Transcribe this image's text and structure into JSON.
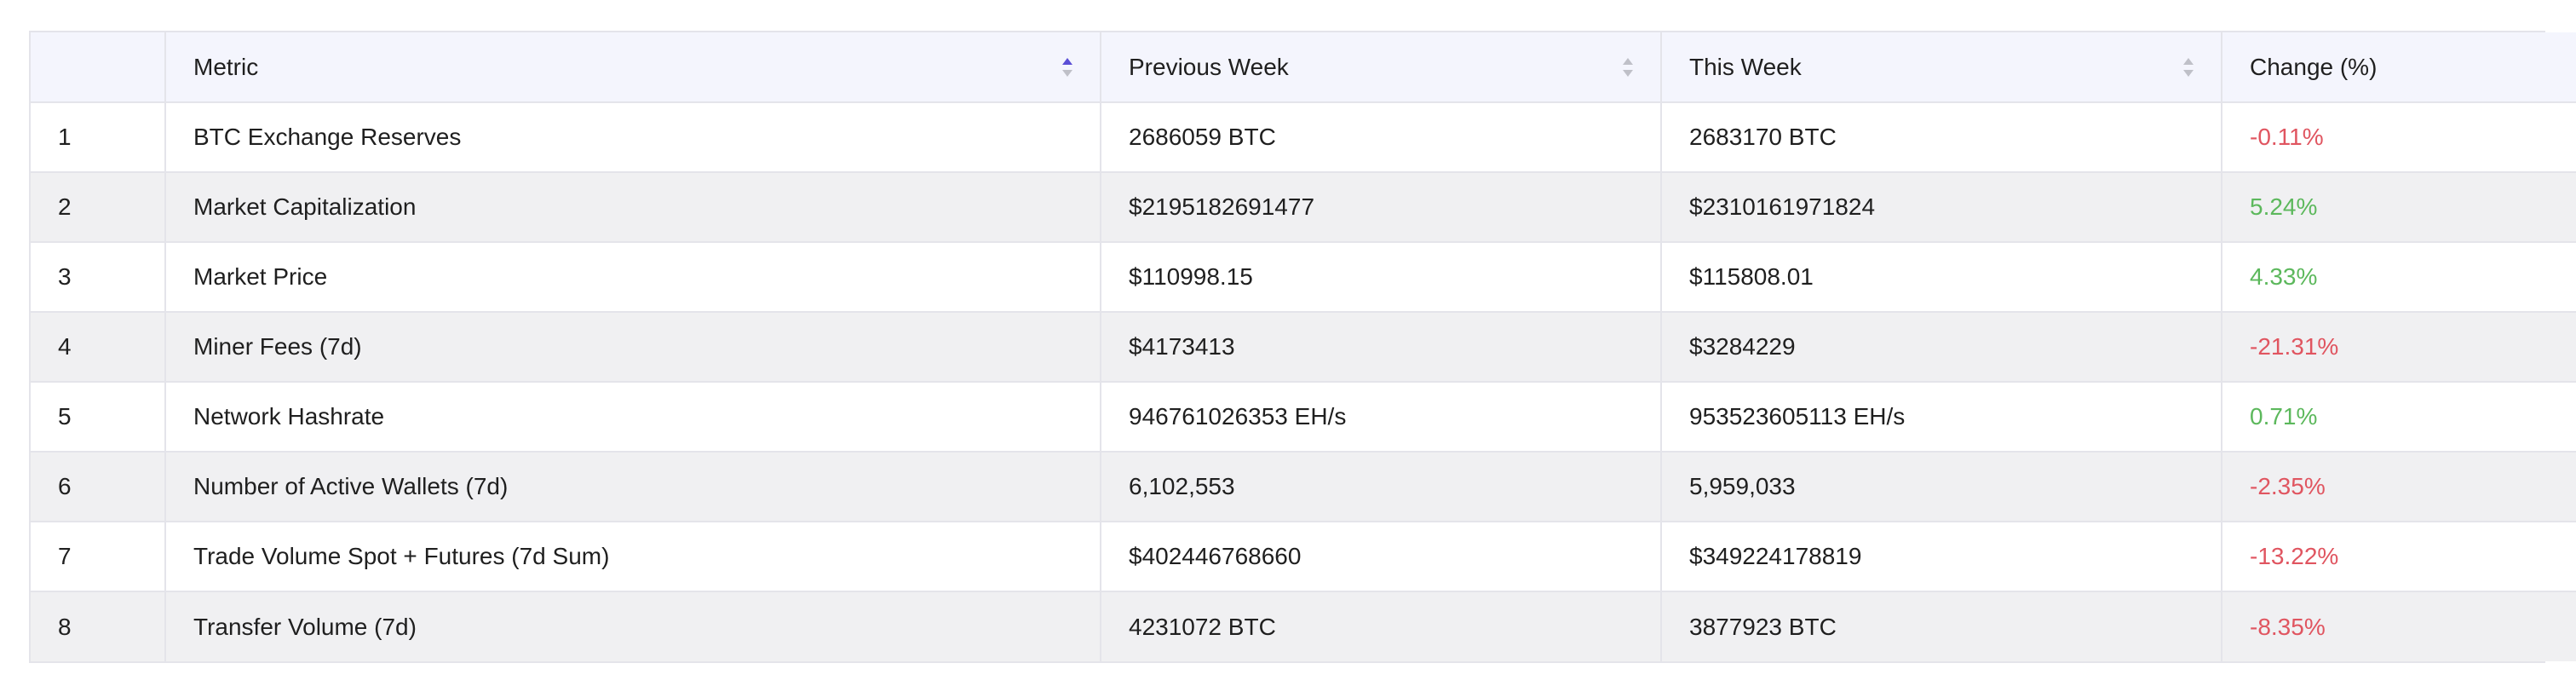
{
  "table": {
    "columns": [
      {
        "label": "",
        "sort": "none"
      },
      {
        "label": "Metric",
        "sort": "asc"
      },
      {
        "label": "Previous Week",
        "sort": "none"
      },
      {
        "label": "This Week",
        "sort": "none"
      },
      {
        "label": "Change (%)",
        "sort": "none"
      }
    ],
    "rows": [
      {
        "index": "1",
        "metric": "BTC Exchange Reserves",
        "previous": "2686059 BTC",
        "current": "2683170 BTC",
        "change": "-0.11%",
        "trend": "negative"
      },
      {
        "index": "2",
        "metric": "Market Capitalization",
        "previous": "$2195182691477",
        "current": "$2310161971824",
        "change": "5.24%",
        "trend": "positive"
      },
      {
        "index": "3",
        "metric": "Market Price",
        "previous": "$110998.15",
        "current": "$115808.01",
        "change": "4.33%",
        "trend": "positive"
      },
      {
        "index": "4",
        "metric": "Miner Fees (7d)",
        "previous": "$4173413",
        "current": "$3284229",
        "change": "-21.31%",
        "trend": "negative"
      },
      {
        "index": "5",
        "metric": "Network Hashrate",
        "previous": "946761026353 EH/s",
        "current": "953523605113 EH/s",
        "change": "0.71%",
        "trend": "positive"
      },
      {
        "index": "6",
        "metric": "Number of Active Wallets (7d)",
        "previous": "6,102,553",
        "current": "5,959,033",
        "change": "-2.35%",
        "trend": "negative"
      },
      {
        "index": "7",
        "metric": "Trade Volume Spot + Futures (7d Sum)",
        "previous": "$402446768660",
        "current": "$349224178819",
        "change": "-13.22%",
        "trend": "negative"
      },
      {
        "index": "8",
        "metric": "Transfer Volume (7d)",
        "previous": "4231072 BTC",
        "current": "3877923 BTC",
        "change": "-8.35%",
        "trend": "negative"
      }
    ]
  },
  "colors": {
    "header_bg": "#f4f5fd",
    "stripe_bg": "#f0f0f2",
    "border": "#e4e4ea",
    "positive": "#5cb85c",
    "negative": "#e05560",
    "sort_active": "#5b4fd6",
    "sort_inactive": "#bfc0c8"
  },
  "icons": {
    "sort": "sort-arrows-icon"
  }
}
